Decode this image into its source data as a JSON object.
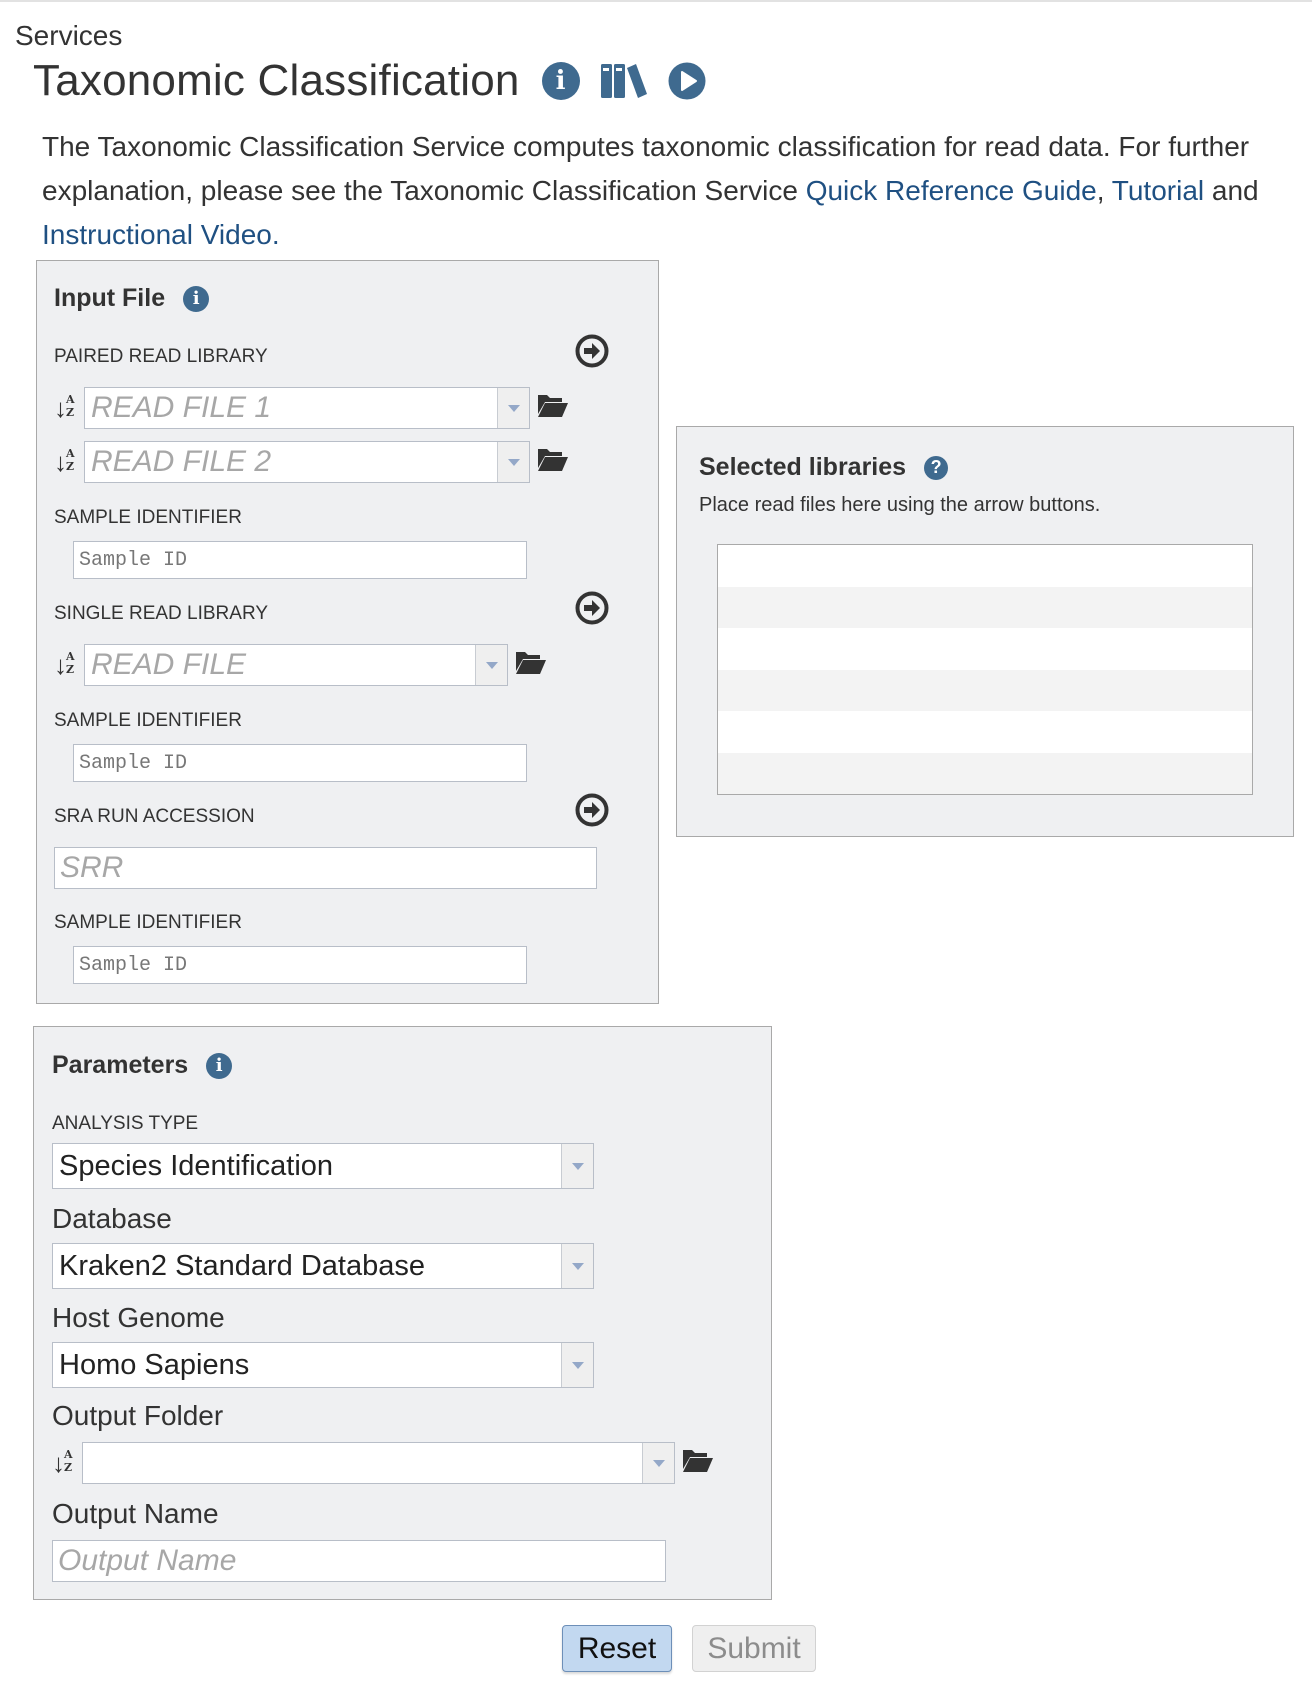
{
  "breadcrumb": "Services",
  "page": {
    "title": "Taxonomic Classification",
    "icons": [
      "info-icon",
      "books-icon",
      "play-icon"
    ]
  },
  "description": {
    "text_before": "The Taxonomic Classification Service computes taxonomic classification for read data. For further explanation, please see the Taxonomic Classification Service ",
    "link1": "Quick Reference Guide",
    "sep": ", ",
    "link2": "Tutorial",
    "and": " and ",
    "link3": "Instructional Video",
    "end": "."
  },
  "input_file": {
    "heading": "Input File",
    "paired": {
      "label": "PAIRED READ LIBRARY",
      "read1_placeholder": "READ FILE 1",
      "read2_placeholder": "READ FILE 2",
      "sample_label": "SAMPLE IDENTIFIER",
      "sample_placeholder": "Sample ID"
    },
    "single": {
      "label": "SINGLE READ LIBRARY",
      "read_placeholder": "READ FILE",
      "sample_label": "SAMPLE IDENTIFIER",
      "sample_placeholder": "Sample ID"
    },
    "sra": {
      "label": "SRA RUN ACCESSION",
      "placeholder": "SRR",
      "sample_label": "SAMPLE IDENTIFIER",
      "sample_placeholder": "Sample ID"
    },
    "sort_icon_letters": {
      "top": "A",
      "bottom": "Z",
      "arrow": "↓"
    }
  },
  "selected_libraries": {
    "heading": "Selected libraries",
    "description": "Place read files here using the arrow buttons.",
    "rows": [
      "",
      "",
      "",
      "",
      "",
      ""
    ]
  },
  "parameters": {
    "heading": "Parameters",
    "analysis_type": {
      "label": "ANALYSIS TYPE",
      "value": "Species Identification"
    },
    "database": {
      "label": "Database",
      "value": "Kraken2 Standard Database"
    },
    "host_genome": {
      "label": "Host Genome",
      "value": "Homo Sapiens"
    },
    "output_folder": {
      "label": "Output Folder",
      "value": ""
    },
    "output_name": {
      "label": "Output Name",
      "placeholder": "Output Name",
      "value": ""
    }
  },
  "buttons": {
    "reset": "Reset",
    "submit": "Submit"
  },
  "colors": {
    "accent_icon": "#3f6a8f",
    "link": "#1f5082",
    "panel_bg": "#eff0f2",
    "reset_bg": "#c2d8f0"
  }
}
